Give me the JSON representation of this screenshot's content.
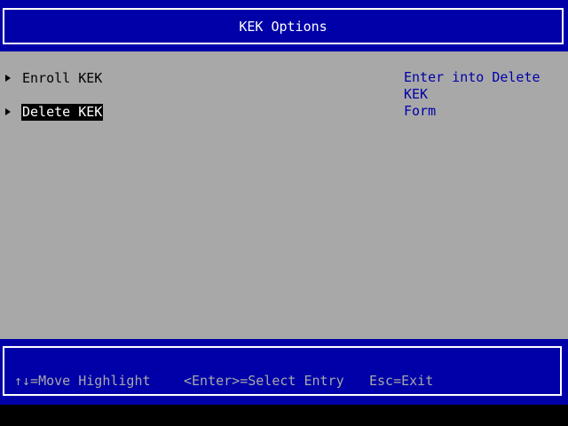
{
  "header": {
    "title": "KEK Options"
  },
  "menu": {
    "items": [
      {
        "label": "Enroll KEK",
        "selected": false
      },
      {
        "label": "Delete KEK",
        "selected": true
      }
    ]
  },
  "help": {
    "text": "Enter into Delete KEK\nForm"
  },
  "footer": {
    "move_hint": "↑↓=Move Highlight",
    "enter_hint": "<Enter>=Select Entry",
    "esc_hint": "Esc=Exit"
  },
  "colors": {
    "header_bg": "#0000a8",
    "body_bg": "#a8a8a8",
    "help_text": "#0000a8",
    "selected_bg": "#000000",
    "selected_fg": "#ffffff"
  },
  "icons": {
    "menu_item": "right-pointer-icon"
  }
}
